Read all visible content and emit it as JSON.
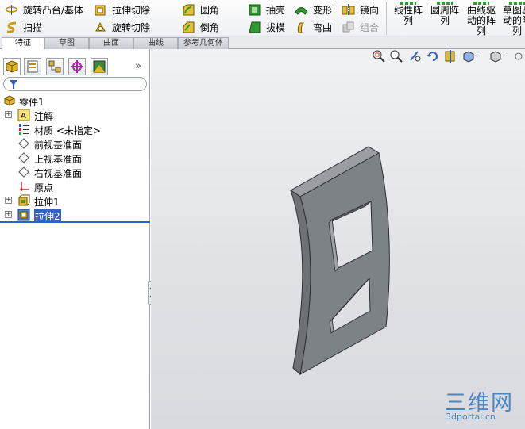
{
  "ribbon": {
    "revolved_boss": "旋转凸台/基体",
    "sweep": "扫描",
    "extruded_cut": "拉伸切除",
    "revolved_cut": "旋转切除",
    "fillet": "圆角",
    "chamfer": "倒角",
    "shell": "抽壳",
    "draft": "拔模",
    "deform": "变形",
    "flex": "弯曲",
    "mirror": "镜向",
    "combine": "组合",
    "linear_pattern": "线性阵\n列",
    "circular_pattern": "圆周阵\n列",
    "curve_driven_pattern": "曲线驱\n动的阵\n列",
    "sketch_driven_pattern": "草图驱\n动的阵\n列"
  },
  "tabs": [
    "特征",
    "草图",
    "曲面",
    "曲线",
    "参考几何体"
  ],
  "panel": {
    "tree": [
      {
        "label": "零件1",
        "icon": "part-icon"
      },
      {
        "label": "注解",
        "icon": "annotation-icon"
      },
      {
        "label": "材质 <未指定>",
        "icon": "material-icon"
      },
      {
        "label": "前视基准面",
        "icon": "plane-icon"
      },
      {
        "label": "上视基准面",
        "icon": "plane-icon"
      },
      {
        "label": "右视基准面",
        "icon": "plane-icon"
      },
      {
        "label": "原点",
        "icon": "origin-icon"
      },
      {
        "label": "拉伸1",
        "icon": "extrude-icon"
      },
      {
        "label": "拉伸2",
        "icon": "extrude-cut-icon",
        "selected": true
      }
    ]
  },
  "watermark": {
    "big": "三维网",
    "small": "3dportal.cn"
  },
  "colors": {
    "accent": "#3163c5",
    "model": "#7d8287",
    "viewport_bg": "#e3e5e9"
  }
}
